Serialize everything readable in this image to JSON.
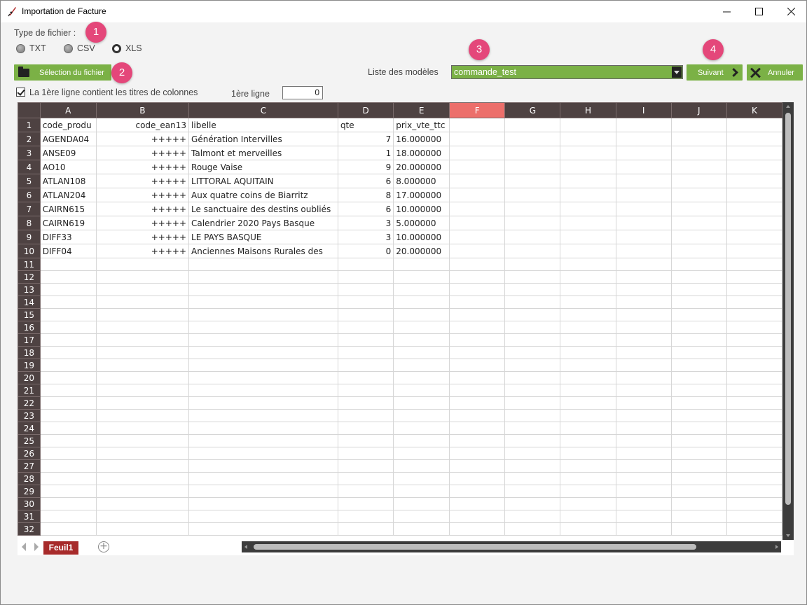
{
  "window": {
    "title": "Importation de Facture",
    "minimize_icon": "minimize-icon",
    "maximize_icon": "maximize-icon",
    "close_icon": "close-icon"
  },
  "file_type": {
    "label": "Type de fichier :",
    "options": [
      "TXT",
      "CSV",
      "XLS"
    ],
    "selected": "XLS"
  },
  "badges": [
    "1",
    "2",
    "3",
    "4"
  ],
  "select_file_button": {
    "label": "Sélection du fichier",
    "icon": "folder-icon"
  },
  "models": {
    "label": "Liste des modèles",
    "value": "commande_test"
  },
  "next_button": {
    "label": "Suivant",
    "icon": "chevron-right-icon"
  },
  "cancel_button": {
    "label": "Annuler",
    "icon": "x-icon"
  },
  "header_checkbox": {
    "label": "La 1ère ligne contient les titres de colonnes",
    "checked": true
  },
  "first_line": {
    "label": "1ère ligne",
    "value": "0"
  },
  "sheet": {
    "columns": [
      "A",
      "B",
      "C",
      "D",
      "E",
      "F",
      "G",
      "H",
      "I",
      "J",
      "K"
    ],
    "selected_column": "F",
    "row_numbers": [
      "1",
      "2",
      "3",
      "4",
      "5",
      "6",
      "7",
      "8",
      "9",
      "10",
      "11",
      "12",
      "13",
      "14",
      "15",
      "16",
      "17",
      "18",
      "19",
      "20",
      "21",
      "22",
      "23",
      "24",
      "25",
      "26",
      "27",
      "28",
      "29",
      "30",
      "31",
      "32"
    ],
    "rows": [
      [
        "code_produ",
        "code_ean13",
        "libelle",
        "qte",
        "prix_vte_ttc"
      ],
      [
        "AGENDA04",
        "+++++",
        "Génération Intervilles",
        "7",
        "16.000000"
      ],
      [
        "ANSE09",
        "+++++",
        "Talmont et merveilles",
        "1",
        "18.000000"
      ],
      [
        "AO10",
        "+++++",
        "Rouge Vaise",
        "9",
        "20.000000"
      ],
      [
        "ATLAN108",
        "+++++",
        "LITTORAL AQUITAIN",
        "6",
        "8.000000"
      ],
      [
        "ATLAN204",
        "+++++",
        "Aux quatre coins de Biarritz",
        "8",
        "17.000000"
      ],
      [
        "CAIRN615",
        "+++++",
        "Le sanctuaire des destins oubliés",
        "6",
        "10.000000"
      ],
      [
        "CAIRN619",
        "+++++",
        "Calendrier 2020 Pays Basque",
        "3",
        "5.000000"
      ],
      [
        "DIFF33",
        "+++++",
        "LE PAYS BASQUE",
        "3",
        "10.000000"
      ],
      [
        "DIFF04",
        "+++++",
        "Anciennes Maisons Rurales des",
        "0",
        "20.000000"
      ]
    ],
    "tab_name": "Feuil1",
    "add_sheet_icon": "plus-icon"
  },
  "colors": {
    "accent_green": "#7bb146",
    "badge_pink": "#e4477a",
    "header_dark": "#4e4242",
    "selected_col": "#ec6f6b",
    "tab_red": "#a72a2a"
  }
}
